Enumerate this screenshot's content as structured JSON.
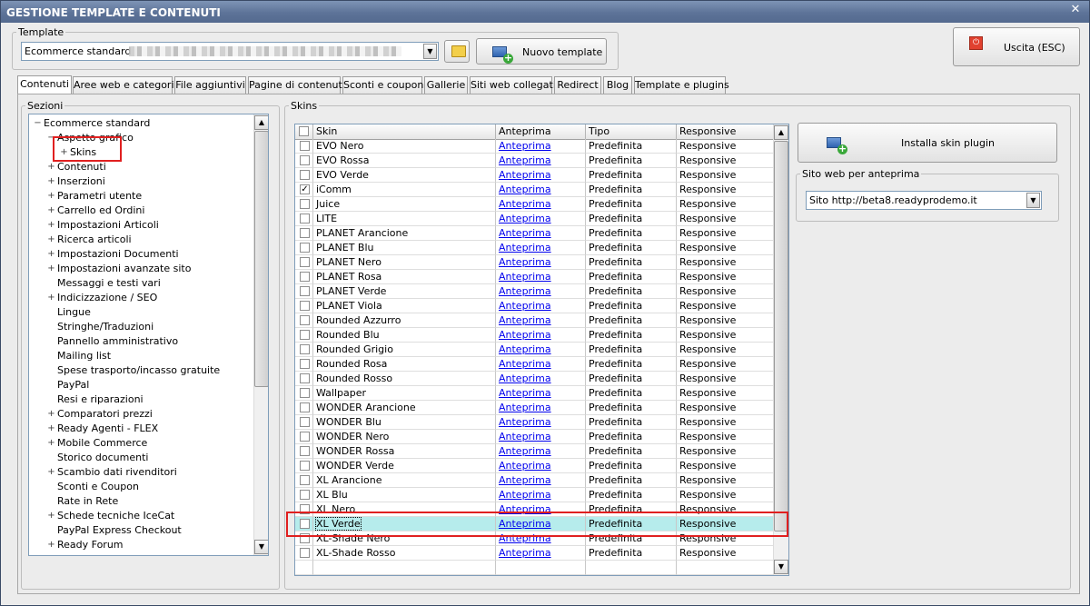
{
  "window": {
    "title": "GESTIONE TEMPLATE E CONTENUTI"
  },
  "template_group": {
    "legend": "Template",
    "selected": "Ecommerce standard",
    "new_template_label": "Nuovo template"
  },
  "exit_label": "Uscita (ESC)",
  "tabs": [
    {
      "label": "Contenuti",
      "active": true
    },
    {
      "label": "Aree web e categorie"
    },
    {
      "label": "File aggiuntivi"
    },
    {
      "label": "Pagine di contenuti"
    },
    {
      "label": "Sconti e coupon"
    },
    {
      "label": "Gallerie"
    },
    {
      "label": "Siti web collegati"
    },
    {
      "label": "Redirect"
    },
    {
      "label": "Blog"
    },
    {
      "label": "Template e plugins"
    }
  ],
  "sections": {
    "legend": "Sezioni",
    "tree": [
      {
        "label": "Ecommerce standard",
        "level": 0,
        "expander": "−"
      },
      {
        "label": "Aspetto grafico",
        "level": 1,
        "expander": "−"
      },
      {
        "label": "Skins",
        "level": 2,
        "expander": "+"
      },
      {
        "label": "Contenuti",
        "level": 1,
        "expander": "+"
      },
      {
        "label": "Inserzioni",
        "level": 1,
        "expander": "+"
      },
      {
        "label": "Parametri utente",
        "level": 1,
        "expander": "+"
      },
      {
        "label": "Carrello ed Ordini",
        "level": 1,
        "expander": "+"
      },
      {
        "label": "Impostazioni Articoli",
        "level": 1,
        "expander": "+"
      },
      {
        "label": "Ricerca articoli",
        "level": 1,
        "expander": "+"
      },
      {
        "label": "Impostazioni Documenti",
        "level": 1,
        "expander": "+"
      },
      {
        "label": "Impostazioni avanzate sito",
        "level": 1,
        "expander": "+"
      },
      {
        "label": "Messaggi e testi vari",
        "level": 1,
        "expander": ""
      },
      {
        "label": "Indicizzazione / SEO",
        "level": 1,
        "expander": "+"
      },
      {
        "label": "Lingue",
        "level": 1,
        "expander": ""
      },
      {
        "label": "Stringhe/Traduzioni",
        "level": 1,
        "expander": ""
      },
      {
        "label": "Pannello amministrativo",
        "level": 1,
        "expander": ""
      },
      {
        "label": "Mailing list",
        "level": 1,
        "expander": ""
      },
      {
        "label": "Spese trasporto/incasso gratuite",
        "level": 1,
        "expander": ""
      },
      {
        "label": "PayPal",
        "level": 1,
        "expander": ""
      },
      {
        "label": "Resi e riparazioni",
        "level": 1,
        "expander": ""
      },
      {
        "label": "Comparatori prezzi",
        "level": 1,
        "expander": "+"
      },
      {
        "label": "Ready Agenti - FLEX",
        "level": 1,
        "expander": "+"
      },
      {
        "label": "Mobile Commerce",
        "level": 1,
        "expander": "+"
      },
      {
        "label": "Storico documenti",
        "level": 1,
        "expander": ""
      },
      {
        "label": "Scambio dati rivenditori",
        "level": 1,
        "expander": "+"
      },
      {
        "label": "Sconti e Coupon",
        "level": 1,
        "expander": ""
      },
      {
        "label": "Rate in Rete",
        "level": 1,
        "expander": ""
      },
      {
        "label": "Schede tecniche IceCat",
        "level": 1,
        "expander": "+"
      },
      {
        "label": "PayPal Express Checkout",
        "level": 1,
        "expander": ""
      },
      {
        "label": "Ready Forum",
        "level": 1,
        "expander": "+"
      }
    ]
  },
  "skins": {
    "legend": "Skins",
    "columns": [
      "Skin",
      "Anteprima",
      "Tipo",
      "Responsive"
    ],
    "rows": [
      {
        "skin": "EVO Nero",
        "preview": "Anteprima",
        "type": "Predefinita",
        "responsive": "Responsive",
        "checked": false
      },
      {
        "skin": "EVO Rossa",
        "preview": "Anteprima",
        "type": "Predefinita",
        "responsive": "Responsive",
        "checked": false
      },
      {
        "skin": "EVO Verde",
        "preview": "Anteprima",
        "type": "Predefinita",
        "responsive": "Responsive",
        "checked": false
      },
      {
        "skin": "iComm",
        "preview": "Anteprima",
        "type": "Predefinita",
        "responsive": "Responsive",
        "checked": true
      },
      {
        "skin": "Juice",
        "preview": "Anteprima",
        "type": "Predefinita",
        "responsive": "Responsive",
        "checked": false
      },
      {
        "skin": "LITE",
        "preview": "Anteprima",
        "type": "Predefinita",
        "responsive": "Responsive",
        "checked": false
      },
      {
        "skin": "PLANET Arancione",
        "preview": "Anteprima",
        "type": "Predefinita",
        "responsive": "Responsive",
        "checked": false
      },
      {
        "skin": "PLANET Blu",
        "preview": "Anteprima",
        "type": "Predefinita",
        "responsive": "Responsive",
        "checked": false
      },
      {
        "skin": "PLANET Nero",
        "preview": "Anteprima",
        "type": "Predefinita",
        "responsive": "Responsive",
        "checked": false
      },
      {
        "skin": "PLANET Rosa",
        "preview": "Anteprima",
        "type": "Predefinita",
        "responsive": "Responsive",
        "checked": false
      },
      {
        "skin": "PLANET Verde",
        "preview": "Anteprima",
        "type": "Predefinita",
        "responsive": "Responsive",
        "checked": false
      },
      {
        "skin": "PLANET Viola",
        "preview": "Anteprima",
        "type": "Predefinita",
        "responsive": "Responsive",
        "checked": false
      },
      {
        "skin": "Rounded Azzurro",
        "preview": "Anteprima",
        "type": "Predefinita",
        "responsive": "Responsive",
        "checked": false
      },
      {
        "skin": "Rounded Blu",
        "preview": "Anteprima",
        "type": "Predefinita",
        "responsive": "Responsive",
        "checked": false
      },
      {
        "skin": "Rounded Grigio",
        "preview": "Anteprima",
        "type": "Predefinita",
        "responsive": "Responsive",
        "checked": false
      },
      {
        "skin": "Rounded Rosa",
        "preview": "Anteprima",
        "type": "Predefinita",
        "responsive": "Responsive",
        "checked": false
      },
      {
        "skin": "Rounded Rosso",
        "preview": "Anteprima",
        "type": "Predefinita",
        "responsive": "Responsive",
        "checked": false
      },
      {
        "skin": "Wallpaper",
        "preview": "Anteprima",
        "type": "Predefinita",
        "responsive": "Responsive",
        "checked": false
      },
      {
        "skin": "WONDER Arancione",
        "preview": "Anteprima",
        "type": "Predefinita",
        "responsive": "Responsive",
        "checked": false
      },
      {
        "skin": "WONDER Blu",
        "preview": "Anteprima",
        "type": "Predefinita",
        "responsive": "Responsive",
        "checked": false
      },
      {
        "skin": "WONDER Nero",
        "preview": "Anteprima",
        "type": "Predefinita",
        "responsive": "Responsive",
        "checked": false
      },
      {
        "skin": "WONDER Rossa",
        "preview": "Anteprima",
        "type": "Predefinita",
        "responsive": "Responsive",
        "checked": false
      },
      {
        "skin": "WONDER Verde",
        "preview": "Anteprima",
        "type": "Predefinita",
        "responsive": "Responsive",
        "checked": false
      },
      {
        "skin": "XL Arancione",
        "preview": "Anteprima",
        "type": "Predefinita",
        "responsive": "Responsive",
        "checked": false
      },
      {
        "skin": "XL Blu",
        "preview": "Anteprima",
        "type": "Predefinita",
        "responsive": "Responsive",
        "checked": false
      },
      {
        "skin": "XL Nero",
        "preview": "Anteprima",
        "type": "Predefinita",
        "responsive": "Responsive",
        "checked": false
      },
      {
        "skin": "XL Verde",
        "preview": "Anteprima",
        "type": "Predefinita",
        "responsive": "Responsive",
        "checked": false,
        "selected": true
      },
      {
        "skin": "XL-Shade Nero",
        "preview": "Anteprima",
        "type": "Predefinita",
        "responsive": "Responsive",
        "checked": false
      },
      {
        "skin": "XL-Shade Rosso",
        "preview": "Anteprima",
        "type": "Predefinita",
        "responsive": "Responsive",
        "checked": false
      }
    ]
  },
  "install_label": "Installa skin plugin",
  "preview_site": {
    "legend": "Sito web per anteprima",
    "value": "Sito http://beta8.readyprodemo.it"
  },
  "colors": {
    "selection": "#b6ecec",
    "highlight": "#e02020",
    "title_bar": "#5d7398"
  }
}
